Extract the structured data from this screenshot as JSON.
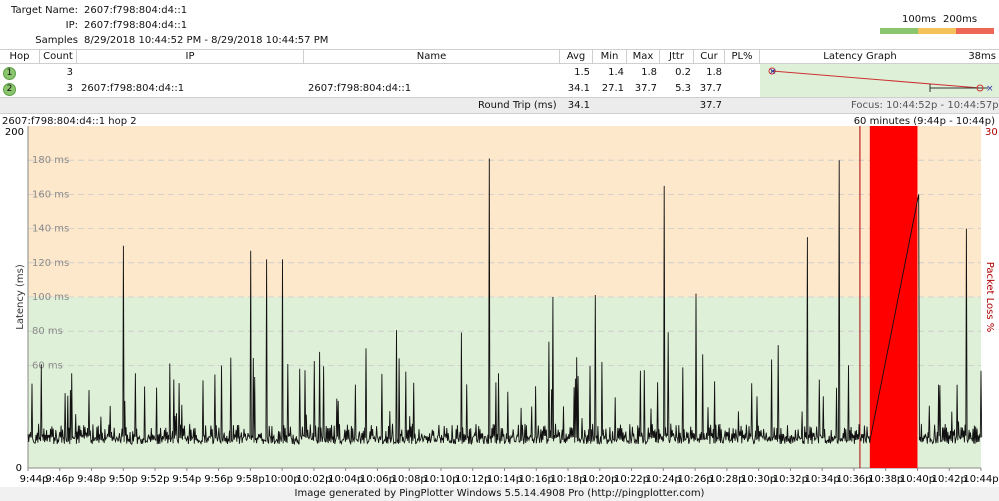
{
  "info": {
    "target_label": "Target Name:",
    "target_value": "2607:f798:804:d4::1",
    "ip_label": "IP:",
    "ip_value": "2607:f798:804:d4::1",
    "samples_label": "Samples Timed:",
    "samples_value": "8/29/2018 10:44:52 PM - 8/29/2018 10:44:57 PM"
  },
  "legend": {
    "label_100": "100ms",
    "label_200": "200ms",
    "colors": [
      "#8bc66f",
      "#f5c15d",
      "#ee6655"
    ]
  },
  "table": {
    "headers": [
      "Hop",
      "Count",
      "IP",
      "Name",
      "Avg",
      "Min",
      "Max",
      "Jttr",
      "Cur",
      "PL%",
      "Latency Graph",
      "38ms"
    ],
    "rows": [
      {
        "hop": "1",
        "count": "3",
        "ip": "",
        "name": "",
        "avg": "1.5",
        "min": "1.4",
        "max": "1.8",
        "jttr": "0.2",
        "cur": "1.8",
        "pl": ""
      },
      {
        "hop": "2",
        "count": "3",
        "ip": "2607:f798:804:d4::1",
        "name": "2607:f798:804:d4::1",
        "avg": "34.1",
        "min": "27.1",
        "max": "37.7",
        "jttr": "5.3",
        "cur": "37.7",
        "pl": ""
      }
    ],
    "round_trip_label": "Round Trip (ms)",
    "round_trip_avg": "34.1",
    "round_trip_cur": "37.7",
    "focus_text": "Focus: 10:44:52p - 10:44:57p"
  },
  "graph": {
    "left_title": "2607:f798:804:d4::1 hop 2",
    "right_title": "60 minutes (9:44p - 10:44p)",
    "y_axis_label": "Latency (ms)",
    "y2_axis_label": "Packet Loss %",
    "y_top": "200",
    "y_bottom": "0",
    "y2_top": "30",
    "y_ticks": [
      "180 ms",
      "160 ms",
      "140 ms",
      "120 ms",
      "100 ms",
      "80 ms",
      "60 ms"
    ],
    "x_ticks": [
      "9:44p",
      "9:46p",
      "9:48p",
      "9:50p",
      "9:52p",
      "9:54p",
      "9:56p",
      "9:58p",
      "10:00p",
      "10:02p",
      "10:04p",
      "10:06p",
      "10:08p",
      "10:10p",
      "10:12p",
      "10:14p",
      "10:16p",
      "10:18p",
      "10:20p",
      "10:22p",
      "10:24p",
      "10:26p",
      "10:28p",
      "10:30p",
      "10:32p",
      "10:34p",
      "10:36p",
      "10:38p",
      "10:40p",
      "10:42p",
      "10:44p"
    ],
    "colors": {
      "warn_zone": "#fde8cc",
      "ok_zone": "#dff0d8",
      "loss": "#ff0000",
      "line": "#111111",
      "loss_axis": "#b00000"
    }
  },
  "chart_data": {
    "type": "line",
    "title": "2607:f798:804:d4::1 hop 2",
    "xlabel": "",
    "ylabel": "Latency (ms)",
    "y2label": "Packet Loss %",
    "ylim": [
      0,
      200
    ],
    "y2lim": [
      0,
      30
    ],
    "x_range": [
      "9:44p",
      "10:44p"
    ],
    "baseline_ms": 14,
    "spikes": [
      {
        "time": "9:50p",
        "ms": 130
      },
      {
        "time": "9:58p",
        "ms": 127
      },
      {
        "time": "9:59p",
        "ms": 122
      },
      {
        "time": "10:00p",
        "ms": 122
      },
      {
        "time": "10:13p",
        "ms": 181
      },
      {
        "time": "10:17p",
        "ms": 100
      },
      {
        "time": "10:24p",
        "ms": 165
      },
      {
        "time": "10:26p",
        "ms": 102
      },
      {
        "time": "10:33p",
        "ms": 135
      },
      {
        "time": "10:35p",
        "ms": 180
      },
      {
        "time": "10:40p",
        "ms": 160
      },
      {
        "time": "10:43p",
        "ms": 140
      }
    ],
    "packet_loss": [
      {
        "start": "10:37p",
        "end": "10:40p",
        "percent": 30
      }
    ],
    "grid": true
  },
  "footer": "Image generated by PingPlotter Windows 5.5.14.4908 Pro (http://pingplotter.com)"
}
